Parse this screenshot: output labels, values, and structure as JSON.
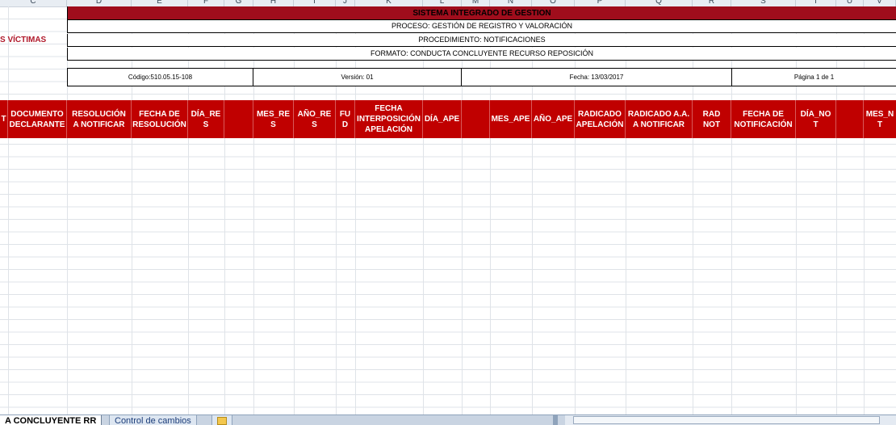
{
  "columns": [
    "C",
    "D",
    "E",
    "F",
    "G",
    "H",
    "I",
    "J",
    "K",
    "L",
    "M",
    "N",
    "O",
    "P",
    "Q",
    "R",
    "S",
    "T",
    "U",
    "V"
  ],
  "logo_text": "S VÍCTIMAS",
  "titles": {
    "system": "SISTEMA INTEGRADO DE GESTION",
    "process": "PROCESO: GESTIÓN DE REGISTRO Y VALORACIÓN",
    "procedure": "PROCEDIMIENTO: NOTIFICACIONES",
    "format": "FORMATO: CONDUCTA CONCLUYENTE RECURSO REPOSICIÓN"
  },
  "info": {
    "code": "Código:510.05.15-108",
    "version": "Versión: 01",
    "date": "Fecha: 13/03/2017",
    "page": "Página 1 de 1"
  },
  "headers": [
    "T",
    "DOCUMENTO\nDECLARANTE",
    "RESOLUCIÓN\nA NOTIFICAR",
    "FECHA DE\nRESOLUCIÓN",
    "DÍA_RE\nS",
    "",
    "MES_RE\nS",
    "AÑO_RE\nS",
    "FU\nD",
    "FECHA\nINTERPOSICIÓN\nAPELACIÓN",
    "DÍA_APE",
    "",
    "MES_APE",
    "AÑO_APE",
    "RADICADO\nAPELACIÓN",
    "RADICADO A.A.\nA NOTIFICAR",
    "RAD\nNOT",
    "FECHA DE\nNOTIFICACIÓN",
    "DÍA_NO\nT",
    "",
    "MES_N\nT"
  ],
  "tabs": {
    "active": "A CONCLUYENTE RR",
    "other": "Control de cambios"
  }
}
